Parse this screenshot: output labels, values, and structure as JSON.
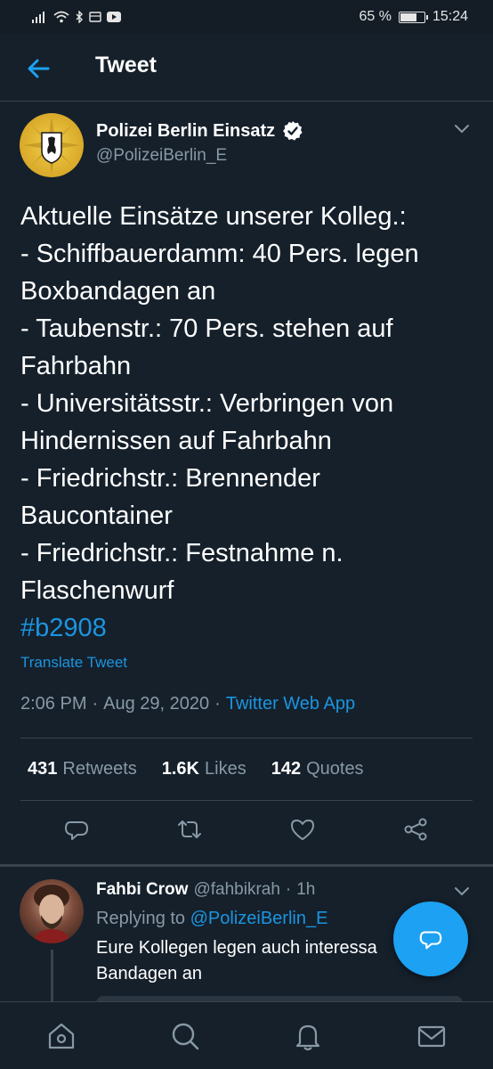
{
  "status_bar": {
    "battery": "65 %",
    "battery_level": 0.65,
    "time": "15:24"
  },
  "header": {
    "title": "Tweet"
  },
  "tweet": {
    "author_name": "Polizei Berlin Einsatz",
    "author_handle": "@PolizeiBerlin_E",
    "verified": true,
    "lines": [
      "Aktuelle Einsätze unserer Kolleg.:",
      "- Schiffbauerdamm: 40 Pers. legen",
      "Boxbandagen an",
      "- Taubenstr.: 70 Pers. stehen auf",
      "Fahrbahn",
      "- Universitätsstr.: Verbringen von",
      "Hindernissen auf Fahrbahn",
      "- Friedrichstr.: Brennender",
      "Baucontainer",
      "- Friedrichstr.: Festnahme n.",
      "Flaschenwurf"
    ],
    "hashtag": "#b2908",
    "translate": "Translate Tweet",
    "time": "2:06 PM",
    "date": "Aug 29, 2020",
    "source": "Twitter Web App",
    "retweets_count": "431",
    "retweets_label": "Retweets",
    "likes_count": "1.6K",
    "likes_label": "Likes",
    "quotes_count": "142",
    "quotes_label": "Quotes"
  },
  "reply": {
    "author_name": "Fahbi Crow",
    "author_handle": "@fahbikrah",
    "age": "1h",
    "replying_prefix": "Replying to",
    "replying_to": "@PolizeiBerlin_E",
    "text_line1": "Eure Kollegen legen auch interessa",
    "text_line2": "Bandagen an"
  },
  "colors": {
    "background": "#15202b",
    "accent": "#1da1f2",
    "link": "#1b95e0",
    "secondary_text": "#8899a6",
    "divider": "#38444d"
  },
  "icons": {
    "back": "arrow-left-icon",
    "verified": "verified-badge-icon",
    "reply": "reply-icon",
    "retweet": "retweet-icon",
    "like": "heart-icon",
    "share": "share-icon",
    "compose": "compose-reply-icon",
    "nav": [
      "home-icon",
      "search-icon",
      "notifications-icon",
      "messages-icon"
    ]
  }
}
